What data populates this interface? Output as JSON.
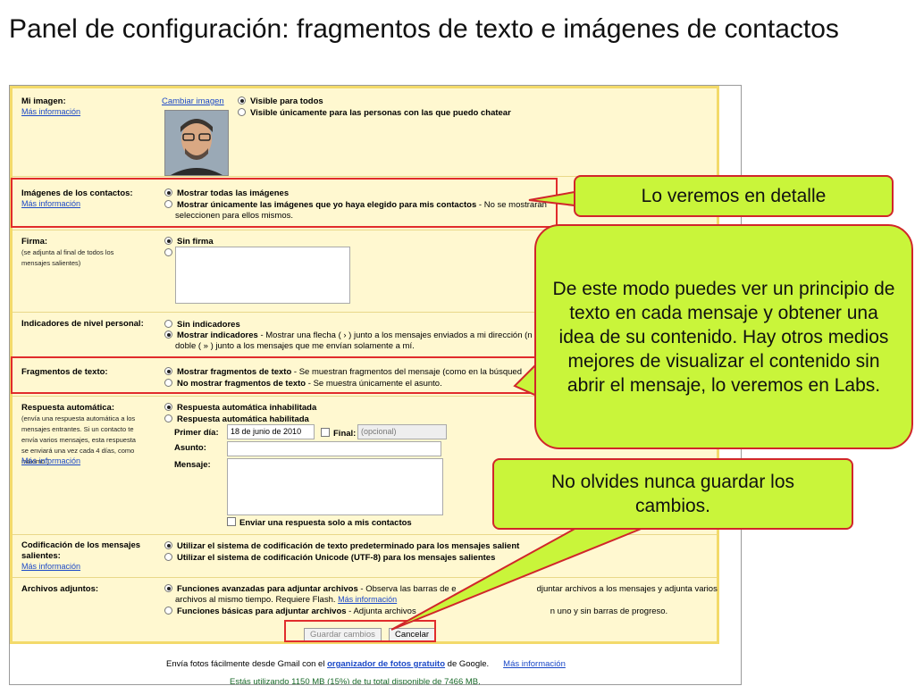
{
  "slide": {
    "title": "Panel de configuración: fragmentos de texto e imágenes de contactos"
  },
  "my_image": {
    "label": "Mi imagen:",
    "more": "Más información",
    "change": "Cambiar imagen",
    "opt1": "Visible para todos",
    "opt2": "Visible únicamente para las personas con las que puedo chatear"
  },
  "contact_images": {
    "label": "Imágenes de los contactos:",
    "more": "Más información",
    "opt1": "Mostrar todas las imágenes",
    "opt2_bold": "Mostrar únicamente las imágenes que yo haya elegido para mis contactos",
    "opt2_rest": " - No se mostrarán",
    "opt2_line2": "seleccionen para ellos mismos."
  },
  "signature": {
    "label": "Firma:",
    "note": "(se adjunta al final de todos los mensajes salientes)",
    "opt1": "Sin firma"
  },
  "indicators": {
    "label": "Indicadores de nivel personal:",
    "opt1": "Sin indicadores",
    "opt2_bold": "Mostrar indicadores",
    "opt2_rest": " - Mostrar una flecha ( › ) junto a los mensajes enviados a mi dirección (n",
    "opt2_line2": "doble ( » ) junto a los mensajes que me envían solamente a mí."
  },
  "snippets": {
    "label": "Fragmentos de texto:",
    "opt1_bold": "Mostrar fragmentos de texto",
    "opt1_rest": " - Se muestran fragmentos del mensaje (como en la búsqued",
    "opt2_bold": "No mostrar fragmentos de texto",
    "opt2_rest": " - Se muestra únicamente el asunto."
  },
  "auto_reply": {
    "label": "Respuesta automática:",
    "note": "(envía una respuesta automática a los mensajes entrantes. Si un contacto te envía varios mensajes, esta respuesta se enviará una vez cada 4 días, como máximo.)",
    "more": "Más información",
    "opt1": "Respuesta automática inhabilitada",
    "opt2": "Respuesta automática habilitada",
    "first_day_label": "Primer día:",
    "first_day_value": "18 de junio de 2010",
    "final_label": "Final:",
    "final_placeholder": "(opcional)",
    "subject_label": "Asunto:",
    "message_label": "Mensaje:",
    "contacts_only": "Enviar una respuesta solo a mis contactos"
  },
  "encoding": {
    "label": "Codificación de los mensajes salientes:",
    "more": "Más información",
    "opt1": "Utilizar el sistema de codificación de texto predeterminado para los mensajes salient",
    "opt2": "Utilizar el sistema de codificación Unicode (UTF-8) para los mensajes salientes"
  },
  "attachments": {
    "label": "Archivos adjuntos:",
    "opt1_bold": "Funciones avanzadas para adjuntar archivos",
    "opt1_rest": " - Observa las barras de e",
    "opt1_rest2": "djuntar archivos a los mensajes y adjunta varios",
    "opt1_line2": "archivos al mismo tiempo. Requiere Flash.",
    "opt1_more": "Más información",
    "opt2_bold": "Funciones básicas para adjuntar archivos",
    "opt2_rest": " - Adjunta archivos",
    "opt2_rest2": "n uno y sin barras de progreso."
  },
  "buttons": {
    "save": "Guardar cambios",
    "cancel": "Cancelar"
  },
  "footer": {
    "pre": "Envía fotos fácilmente desde Gmail con el ",
    "link": "organizador de fotos gratuito",
    "post": " de Google.",
    "more": "Más información",
    "usage": "Estás utilizando 1150 MB (15%) de tu total disponible de 7466 MB."
  },
  "callouts": {
    "c1": "Lo veremos en detalle",
    "c2": "De este modo puedes ver un principio de texto en cada mensaje y obtener una idea de su contenido. Hay otros medios mejores de visualizar el contenido sin abrir el mensaje, lo veremos en Labs.",
    "c3": "No olvides nunca guardar los cambios."
  },
  "colors": {
    "callout_fill": "#c9f53a",
    "highlight": "#e12c2c",
    "panel": "#fff8d0",
    "link": "#1a48c7"
  }
}
